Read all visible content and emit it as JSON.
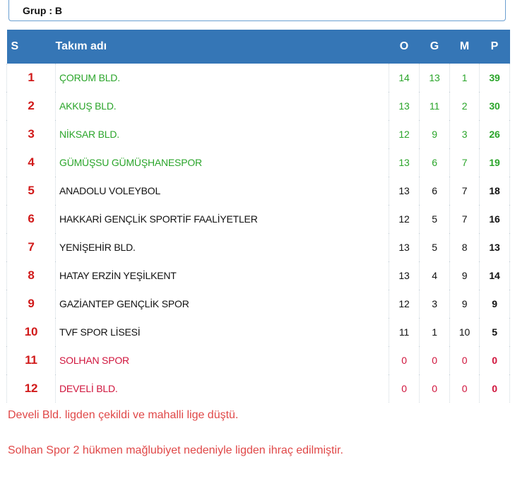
{
  "group": {
    "label": "Grup : B"
  },
  "table": {
    "headers": {
      "s": "S",
      "name": "Takım adı",
      "o": "O",
      "g": "G",
      "m": "M",
      "p": "P"
    },
    "rows": [
      {
        "rank": "1",
        "name": "ÇORUM BLD.",
        "o": "14",
        "g": "13",
        "m": "1",
        "p": "39",
        "status": "promo"
      },
      {
        "rank": "2",
        "name": "AKKUŞ BLD.",
        "o": "13",
        "g": "11",
        "m": "2",
        "p": "30",
        "status": "promo"
      },
      {
        "rank": "3",
        "name": "NİKSAR BLD.",
        "o": "12",
        "g": "9",
        "m": "3",
        "p": "26",
        "status": "promo"
      },
      {
        "rank": "4",
        "name": "GÜMÜŞSU GÜMÜŞHANESPOR",
        "o": "13",
        "g": "6",
        "m": "7",
        "p": "19",
        "status": "promo"
      },
      {
        "rank": "5",
        "name": "ANADOLU VOLEYBOL",
        "o": "13",
        "g": "6",
        "m": "7",
        "p": "18",
        "status": "normal"
      },
      {
        "rank": "6",
        "name": "HAKKARİ GENÇLİK SPORTİF FAALİYETLER",
        "o": "12",
        "g": "5",
        "m": "7",
        "p": "16",
        "status": "normal"
      },
      {
        "rank": "7",
        "name": "YENİŞEHİR BLD.",
        "o": "13",
        "g": "5",
        "m": "8",
        "p": "13",
        "status": "normal"
      },
      {
        "rank": "8",
        "name": "HATAY ERZİN YEŞİLKENT",
        "o": "13",
        "g": "4",
        "m": "9",
        "p": "14",
        "status": "normal"
      },
      {
        "rank": "9",
        "name": "GAZİANTEP GENÇLİK SPOR",
        "o": "12",
        "g": "3",
        "m": "9",
        "p": "9",
        "status": "normal"
      },
      {
        "rank": "10",
        "name": "TVF SPOR LİSESİ",
        "o": "11",
        "g": "1",
        "m": "10",
        "p": "5",
        "status": "normal"
      },
      {
        "rank": "11",
        "name": "SOLHAN SPOR",
        "o": "0",
        "g": "0",
        "m": "0",
        "p": "0",
        "status": "releg"
      },
      {
        "rank": "12",
        "name": "DEVELİ BLD.",
        "o": "0",
        "g": "0",
        "m": "0",
        "p": "0",
        "status": "releg"
      }
    ]
  },
  "notes": [
    "Develi Bld. ligden çekildi ve mahalli lige düştü.",
    "Solhan Spor 2 hükmen mağlubiyet nedeniyle ligden ihraç edilmiştir."
  ],
  "colors": {
    "header_bg": "#3576b6",
    "promo": "#2aa52a",
    "relegation": "#d0143c",
    "rank": "#d11a1a",
    "note": "#e04848"
  }
}
